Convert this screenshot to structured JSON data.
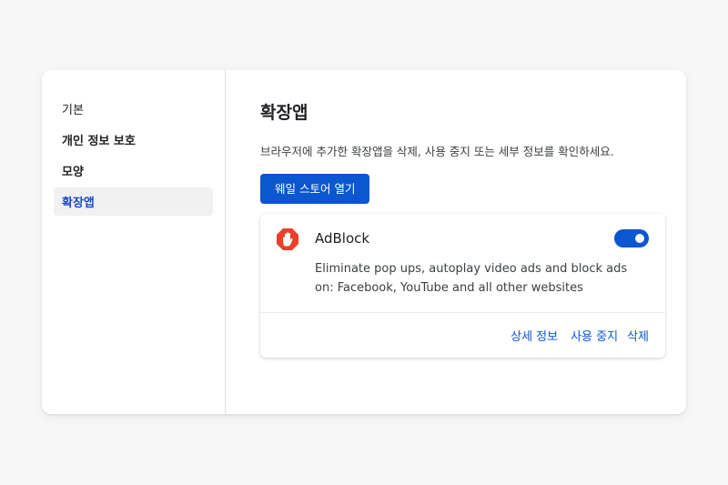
{
  "sidebar": {
    "items": [
      {
        "label": "기본"
      },
      {
        "label": "개인 정보 보호"
      },
      {
        "label": "모양"
      },
      {
        "label": "확장앱"
      }
    ]
  },
  "main": {
    "title": "확장앱",
    "description": "브라우저에 추가한 확장앱을 삭제, 사용 중지 또는 세부 정보를 확인하세요.",
    "store_button_label": "웨일 스토어 열기"
  },
  "extension": {
    "name": "AdBlock",
    "icon": "adblock-hand-icon",
    "description": "Eliminate pop ups, autoplay video ads and block ads on: Facebook, YouTube and all other websites",
    "enabled": true,
    "actions": {
      "details_label": "상세 정보",
      "disable_label": "사용 중지",
      "remove_label": "삭제"
    }
  },
  "colors": {
    "accent": "#0b57d0",
    "active_nav_text": "#1a49c9",
    "adblock_red": "#e8402a"
  }
}
